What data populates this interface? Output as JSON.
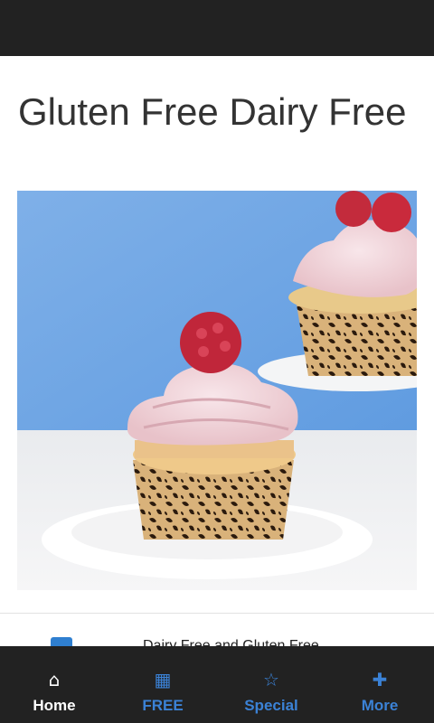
{
  "header": {
    "title": "Gluten Free Dairy Free"
  },
  "hero": {
    "image": "raspberry-cupcake-photo"
  },
  "list": {
    "items": [
      {
        "label": "Dairy Free and Gluten Free",
        "icon": "app-icon"
      }
    ]
  },
  "tabbar": {
    "tabs": [
      {
        "label": "Home",
        "icon": "home-icon",
        "active": true
      },
      {
        "label": "FREE",
        "icon": "gift-icon",
        "active": false
      },
      {
        "label": "Special",
        "icon": "star-icon",
        "active": false
      },
      {
        "label": "More",
        "icon": "plus-icon",
        "active": false
      }
    ]
  },
  "colors": {
    "bar": "#222222",
    "accent": "#3b82d6",
    "title": "#333333",
    "active_tab": "#ffffff"
  }
}
